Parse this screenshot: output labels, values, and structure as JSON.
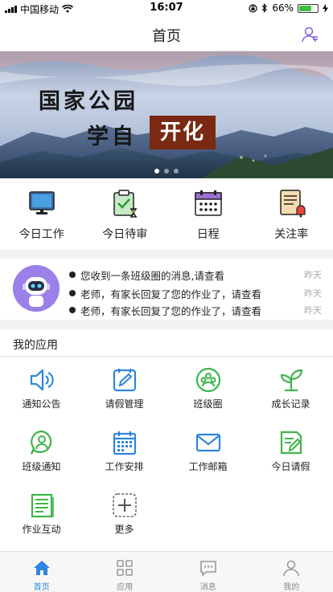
{
  "status": {
    "carrier": "中国移动",
    "time": "16:07",
    "battery": "66%",
    "battery_level": 0.66
  },
  "nav": {
    "title": "首页",
    "user_icon": "user-icon"
  },
  "banner": {
    "line1": "国家公园",
    "line2": "学自",
    "line3": "开化",
    "slides": 3,
    "active_slide": 1
  },
  "quick": [
    {
      "label": "今日工作",
      "icon": "monitor-icon"
    },
    {
      "label": "今日待审",
      "icon": "clipboard-check-icon"
    },
    {
      "label": "日程",
      "icon": "calendar-icon"
    },
    {
      "label": "关注率",
      "icon": "report-bell-icon"
    }
  ],
  "messages": [
    {
      "text": "您收到一条班级圈的消息,请查看",
      "time": "昨天"
    },
    {
      "text": "老师，有家长回复了您的作业了，请查看",
      "time": "昨天"
    },
    {
      "text": "老师，有家长回复了您的作业了，请查看",
      "time": "昨天"
    }
  ],
  "apps": {
    "heading": "我的应用",
    "items": [
      {
        "label": "通知公告",
        "icon": "speaker-icon"
      },
      {
        "label": "请假管理",
        "icon": "edit-board-icon"
      },
      {
        "label": "班级圈",
        "icon": "group-circle-icon"
      },
      {
        "label": "成长记录",
        "icon": "sprout-icon"
      },
      {
        "label": "班级通知",
        "icon": "person-bubble-icon"
      },
      {
        "label": "工作安排",
        "icon": "calendar-grid-icon"
      },
      {
        "label": "工作邮箱",
        "icon": "mail-icon"
      },
      {
        "label": "今日请假",
        "icon": "leave-doc-icon"
      },
      {
        "label": "作业互动",
        "icon": "homework-doc-icon"
      },
      {
        "label": "更多",
        "icon": "plus-icon"
      }
    ]
  },
  "tabbar": [
    {
      "label": "首页",
      "icon": "home-icon",
      "active": true
    },
    {
      "label": "应用",
      "icon": "grid-icon",
      "active": false
    },
    {
      "label": "消息",
      "icon": "chat-icon",
      "active": false
    },
    {
      "label": "我的",
      "icon": "profile-icon",
      "active": false
    }
  ],
  "colors": {
    "accent": "#2e86de",
    "green": "#3cb54a",
    "banner_red": "#7a2a12"
  }
}
